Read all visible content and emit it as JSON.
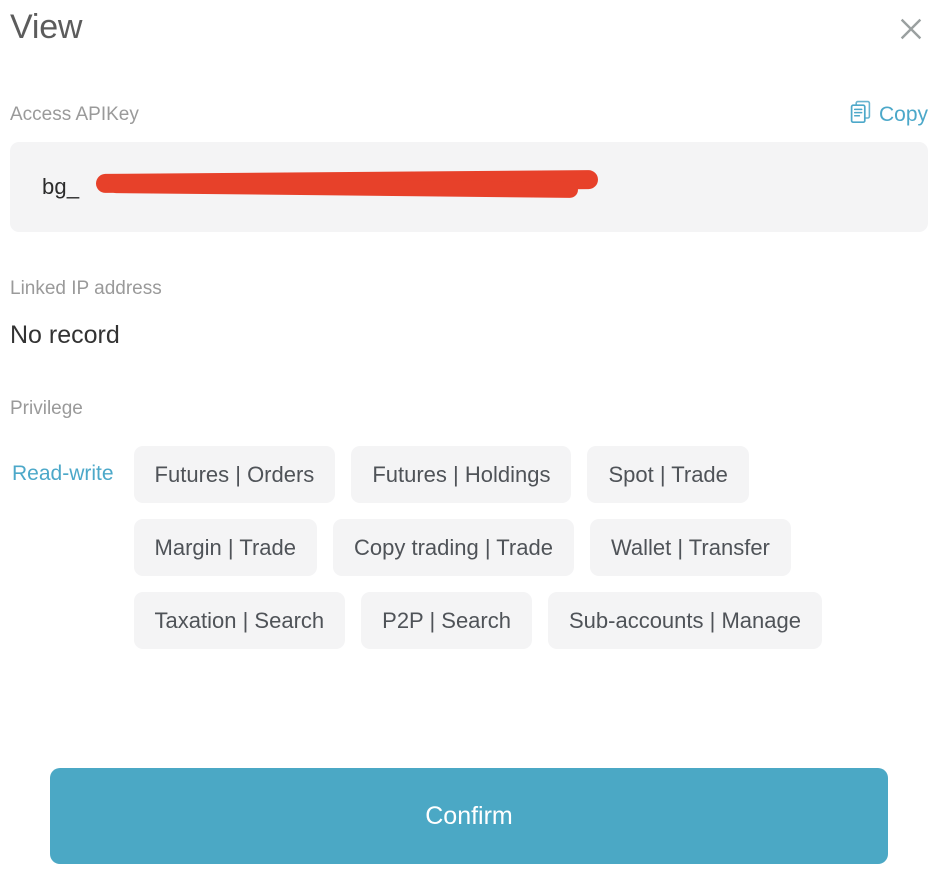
{
  "dialog": {
    "title": "View",
    "close_label": "Close",
    "close_icon": "close-icon"
  },
  "apikey": {
    "label": "Access APIKey",
    "copy_label": "Copy",
    "copy_icon": "copy-documents-icon",
    "value_prefix": "bg_",
    "value_redacted": true,
    "value_masked": "bg_"
  },
  "linked_ip": {
    "label": "Linked IP address",
    "value": "No record"
  },
  "privilege": {
    "label": "Privilege",
    "mode": "Read-write",
    "tags": [
      "Futures | Orders",
      "Futures | Holdings",
      "Spot | Trade",
      "Margin | Trade",
      "Copy trading | Trade",
      "Wallet | Transfer",
      "Taxation | Search",
      "P2P | Search",
      "Sub-accounts | Manage"
    ]
  },
  "footer": {
    "confirm_label": "Confirm"
  },
  "colors": {
    "accent": "#4ca8c9",
    "confirm_button": "#4ba8c5",
    "redaction": "#e7412a",
    "field_background": "#f4f4f5",
    "label_text": "#9a9a9a",
    "value_text": "#333333",
    "title_text": "#5c5c5c",
    "tag_text": "#4f5358"
  }
}
